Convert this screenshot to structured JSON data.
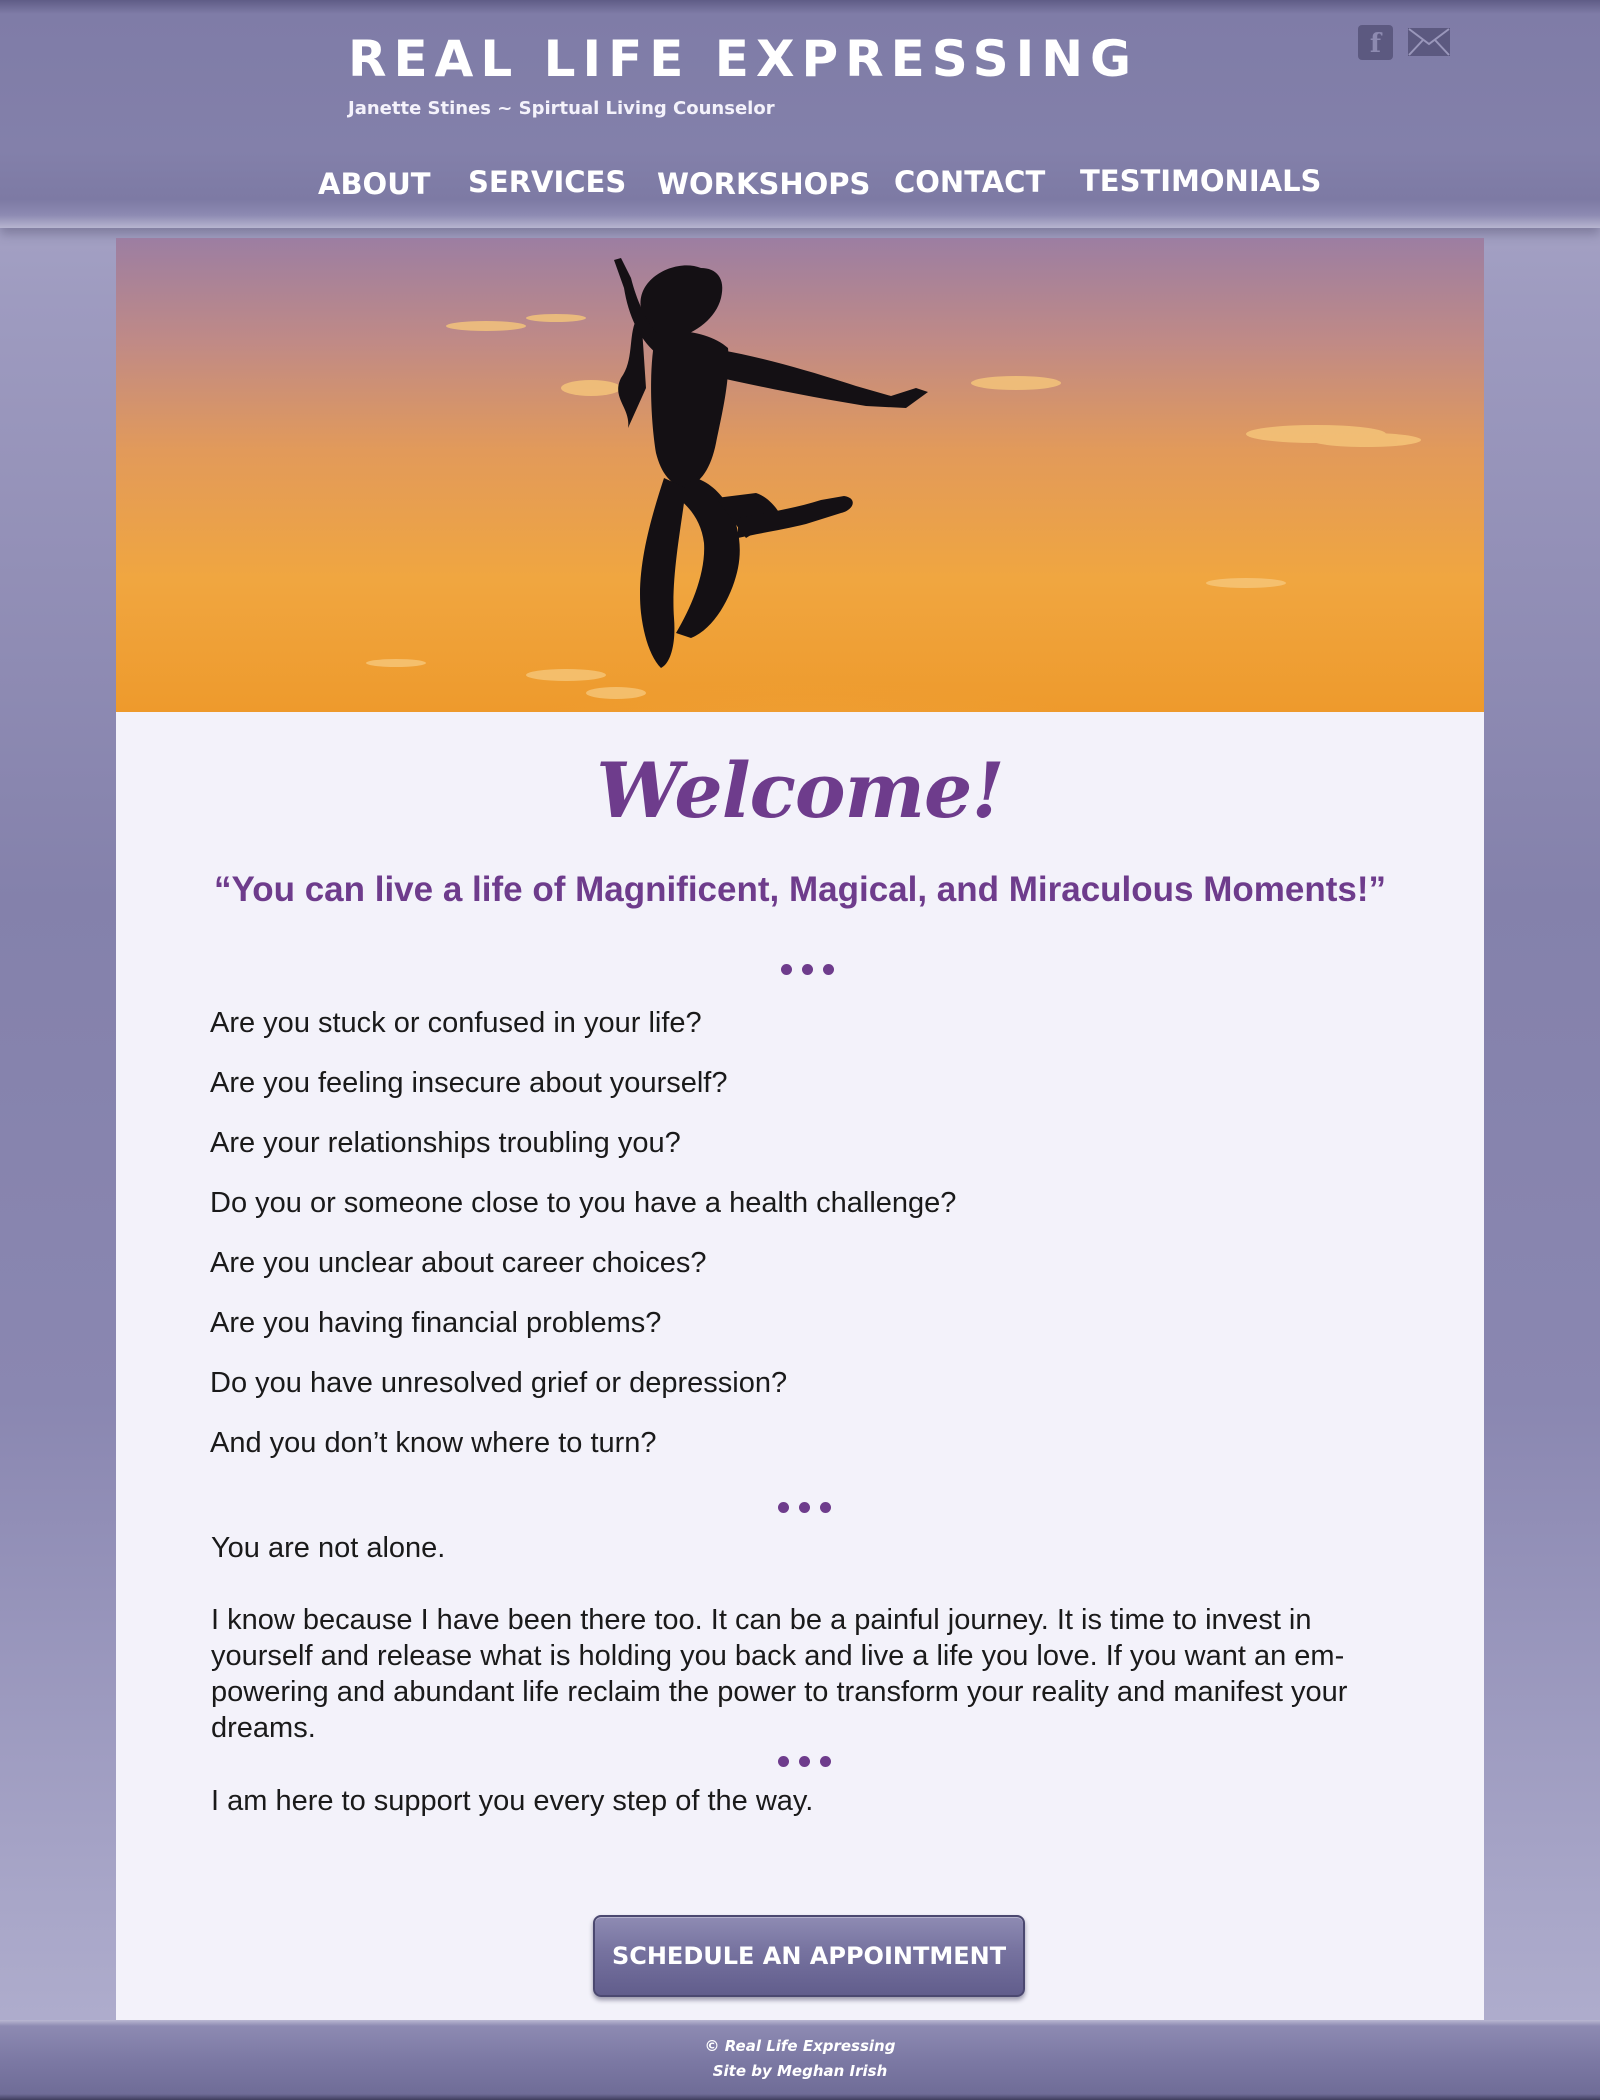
{
  "header": {
    "title": "REAL LIFE EXPRESSING",
    "subtitle": "Janette Stines ~ Spirtual Living Counselor",
    "social": {
      "facebook_icon": "facebook-icon",
      "facebook_glyph": "f",
      "mail_icon": "mail-icon"
    }
  },
  "nav": {
    "items": [
      {
        "label": "ABOUT"
      },
      {
        "label": "SERVICES"
      },
      {
        "label": "WORKSHOPS"
      },
      {
        "label": "CONTACT"
      },
      {
        "label": "TESTIMONIALS"
      }
    ]
  },
  "hero": {
    "image": "silhouette of woman jumping against sunset sky"
  },
  "main": {
    "welcome": "Welcome!",
    "tagline": "“You can live a life of Magnificent, Magical, and Miraculous Moments!”",
    "questions": [
      "Are you stuck or confused in your life?",
      "Are you feeling insecure about yourself?",
      "Are your relationships troubling you?",
      "Do you or someone close to you have a health challenge?",
      "Are you unclear about career choices?",
      "Are you having financial problems?",
      "Do you have unresolved grief or depression?",
      "And you don’t know where to turn?"
    ],
    "not_alone": "You are not alone.",
    "paragraph": "I know because I have been there too. It can be a painful journey.  It is time to invest in yourself and release what is holding you back and live a life you love. If you want an em­powering and abundant life reclaim the power to transform your reality and manifest your dreams.",
    "support": "I am here to support you every step of the way.",
    "cta_label": "SCHEDULE AN APPOINTMENT"
  },
  "footer": {
    "copyright": "© Real Life Expressing",
    "credit": "Site by Meghan Irish"
  },
  "colors": {
    "accent_purple": "#6e3c8c",
    "header_bg": "#8380aa",
    "panel_bg": "#f3f2fa",
    "text": "#1a1a1a"
  }
}
